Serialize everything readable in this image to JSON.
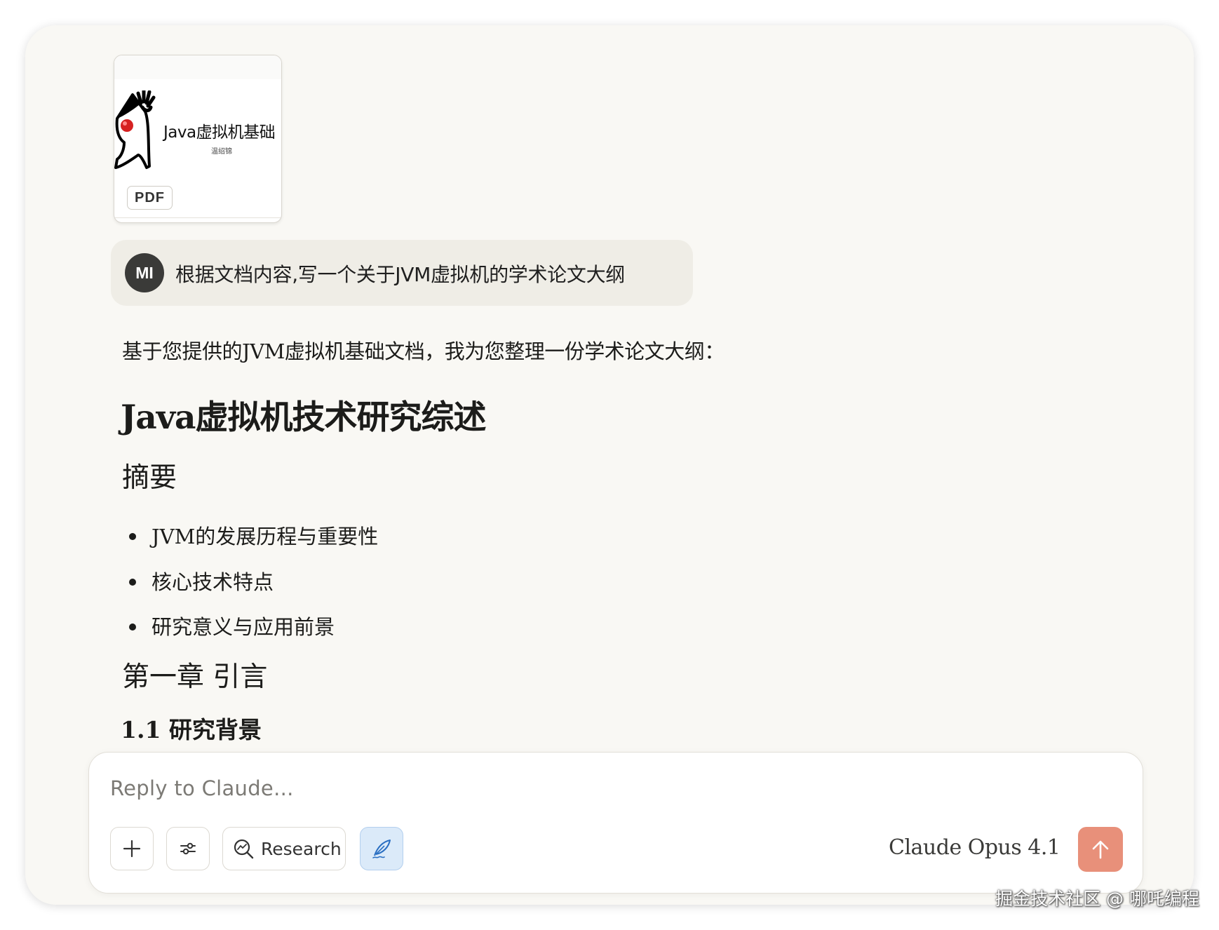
{
  "attachment": {
    "title": "Java虚拟机基础",
    "author": "温绍锦",
    "badge": "PDF"
  },
  "user_message": {
    "avatar_initials": "MI",
    "text": "根据文档内容,写一个关于JVM虚拟机的学术论文大纲"
  },
  "response": {
    "intro": "基于您提供的JVM虚拟机基础文档，我为您整理一份学术论文大纲：",
    "title": "Java虚拟机技术研究综述",
    "abstract_heading": "摘要",
    "abstract_items": [
      "JVM的发展历程与重要性",
      "核心技术特点",
      "研究意义与应用前景"
    ],
    "chapter1_heading": "第一章 引言",
    "section_1_1": "1.1 研究背景"
  },
  "composer": {
    "placeholder": "Reply to Claude...",
    "research_label": "Research",
    "model_label": "Claude Opus 4.1"
  },
  "watermark": "掘金技术社区 @ 哪吒编程",
  "colors": {
    "background": "#f9f8f4",
    "send_button": "#e8907a",
    "style_button": "#dbeaf9"
  }
}
